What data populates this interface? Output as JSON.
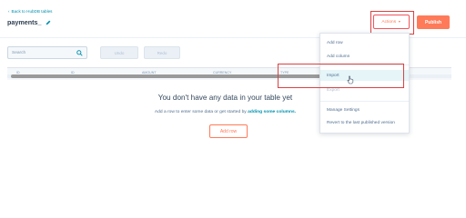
{
  "header": {
    "back_label": "Back to HubDB tables",
    "title": "payments_"
  },
  "toolbar": {
    "actions_label": "Actions",
    "publish_label": "Publish",
    "search_placeholder": "Search",
    "btn_1": "Undo",
    "btn_2": "Redo"
  },
  "table": {
    "columns": [
      "ID",
      "ID",
      "AMOUNT",
      "CURRENCY",
      "TYPE"
    ]
  },
  "empty_state": {
    "title": "You don't have any data in your table yet",
    "subtitle_prefix": "Add a row to enter some data or get started by",
    "subtitle_link": "adding some columns.",
    "add_row_label": "Add row"
  },
  "actions_menu": {
    "items": [
      {
        "label": "Add row"
      },
      {
        "label": "Add column"
      },
      {
        "label": "Import"
      },
      {
        "label": "Export"
      },
      {
        "label": "Manage Settings"
      },
      {
        "label": "Revert to the last published version"
      }
    ]
  },
  "colors": {
    "accent": "#ff7a59",
    "highlight_box": "#d94242",
    "link": "#0091ae"
  }
}
